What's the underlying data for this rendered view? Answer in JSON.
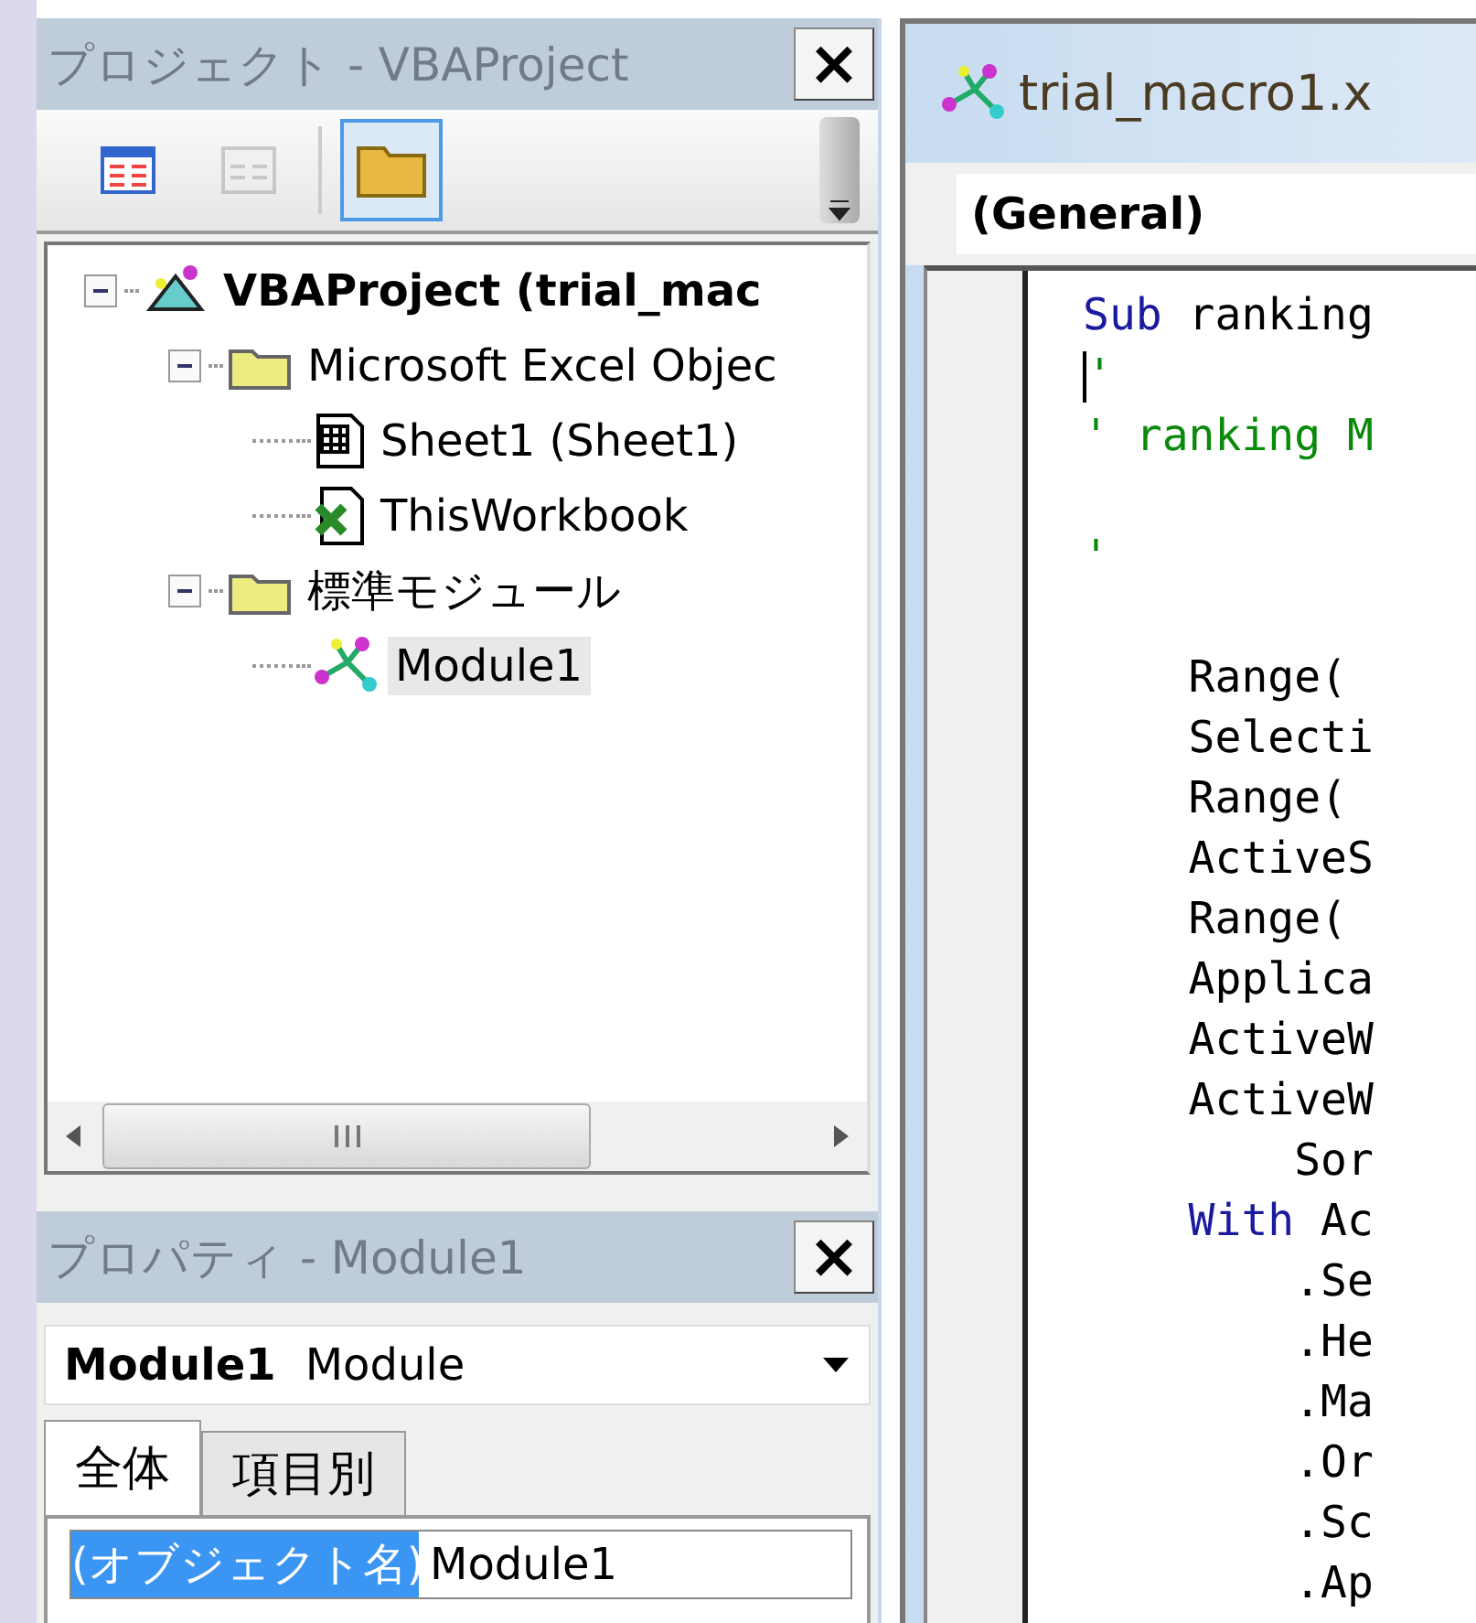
{
  "project_panel": {
    "title": "プロジェクト - VBAProject",
    "close": "×",
    "toolbar": [
      {
        "kind": "view-code",
        "selected": false,
        "disabled": false
      },
      {
        "kind": "view-form",
        "selected": false,
        "disabled": true
      },
      {
        "kind": "folder",
        "selected": true,
        "disabled": false
      }
    ],
    "tree": [
      {
        "label": "VBAProject (trial_mac",
        "kind": "project",
        "bold": true,
        "expanded": true,
        "selected": false,
        "children": [
          {
            "label": "Microsoft Excel Objec",
            "kind": "folder",
            "bold": false,
            "expanded": true,
            "selected": false,
            "children": [
              {
                "label": "Sheet1 (Sheet1)",
                "kind": "sheet",
                "bold": false,
                "selected": false
              },
              {
                "label": "ThisWorkbook",
                "kind": "workbook",
                "bold": false,
                "selected": false
              }
            ]
          },
          {
            "label": "標準モジュール",
            "kind": "folder",
            "bold": false,
            "expanded": true,
            "selected": false,
            "children": [
              {
                "label": "Module1",
                "kind": "module",
                "bold": false,
                "selected": true
              }
            ]
          }
        ]
      }
    ]
  },
  "properties_panel": {
    "title": "プロパティ - Module1",
    "close": "×",
    "object_name": "Module1",
    "object_type": "Module",
    "tabs": [
      {
        "label": "全体",
        "selected": true
      },
      {
        "label": "項目別",
        "selected": false
      }
    ],
    "rows": [
      {
        "name": "(オブジェクト名)",
        "value": "Module1",
        "selected": true
      }
    ]
  },
  "code_window": {
    "title": "trial_macro1.x",
    "object_combo": "(General)",
    "lines": [
      {
        "kind": "keyword-line",
        "keyword": "Sub",
        "text": " ranking"
      },
      {
        "kind": "comment",
        "text": "'",
        "cursor": true
      },
      {
        "kind": "comment",
        "text": "' ranking M",
        "cursor": false
      },
      {
        "kind": "blank"
      },
      {
        "kind": "comment",
        "text": "'",
        "cursor": false
      },
      {
        "kind": "blank"
      },
      {
        "kind": "code",
        "text": "    Range("
      },
      {
        "kind": "code",
        "text": "    Selecti"
      },
      {
        "kind": "code",
        "text": "    Range("
      },
      {
        "kind": "code",
        "text": "    ActiveS"
      },
      {
        "kind": "code",
        "text": "    Range("
      },
      {
        "kind": "code",
        "text": "    Applica"
      },
      {
        "kind": "code",
        "text": "    ActiveW"
      },
      {
        "kind": "code",
        "text": "    ActiveW"
      },
      {
        "kind": "code",
        "text": "        Sor"
      },
      {
        "kind": "keyword-line",
        "keyword": "    With",
        "text": " Ac"
      },
      {
        "kind": "code",
        "text": "        .Se"
      },
      {
        "kind": "code",
        "text": "        .He"
      },
      {
        "kind": "code",
        "text": "        .Ma"
      },
      {
        "kind": "code",
        "text": "        .Or"
      },
      {
        "kind": "code",
        "text": "        .Sc"
      },
      {
        "kind": "code",
        "text": "        .Ap"
      }
    ]
  }
}
